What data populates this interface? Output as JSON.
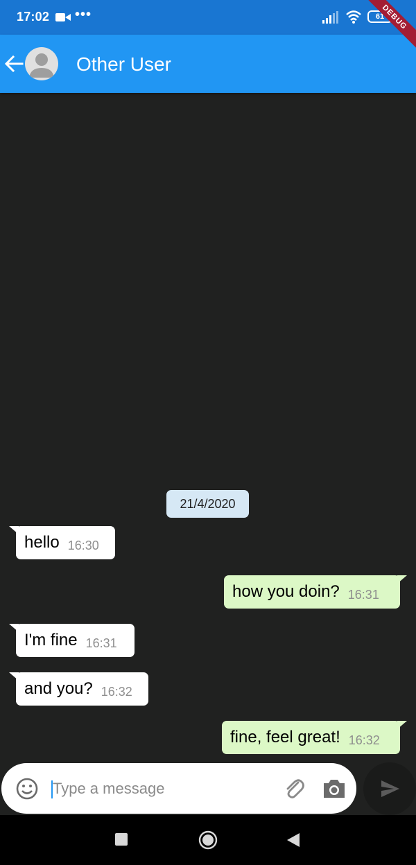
{
  "status_bar": {
    "time": "17:02",
    "dots": "•••",
    "battery": "61",
    "debug_banner": "DEBUG"
  },
  "app_bar": {
    "contact_name": "Other User"
  },
  "conversation": {
    "date_label": "21/4/2020",
    "messages": [
      {
        "direction": "incoming",
        "text": "hello",
        "time": "16:30"
      },
      {
        "direction": "outgoing",
        "text": "how you doin?",
        "time": "16:31"
      },
      {
        "direction": "incoming",
        "text": "I'm fine",
        "time": "16:31"
      },
      {
        "direction": "incoming",
        "text": "and you?",
        "time": "16:32"
      },
      {
        "direction": "outgoing",
        "text": "fine, feel great!",
        "time": "16:32"
      }
    ]
  },
  "composer": {
    "placeholder": "Type a message",
    "value": ""
  },
  "icons": {
    "status": [
      "video-camera-icon",
      "signal-icon",
      "wifi-icon",
      "battery-icon"
    ],
    "app_bar": [
      "back-arrow-icon",
      "avatar-person-icon"
    ],
    "composer": [
      "emoji-icon",
      "attach-icon",
      "camera-icon",
      "send-icon"
    ],
    "nav": [
      "recents-icon",
      "home-icon",
      "back-triangle-icon"
    ]
  },
  "colors": {
    "status_bar": "#1976d2",
    "app_bar": "#2196f3",
    "background": "#202120",
    "incoming_bubble": "#ffffff",
    "outgoing_bubble": "#dcf8c6",
    "date_chip": "#d6e8f5",
    "timestamp": "#8e8e8e"
  }
}
